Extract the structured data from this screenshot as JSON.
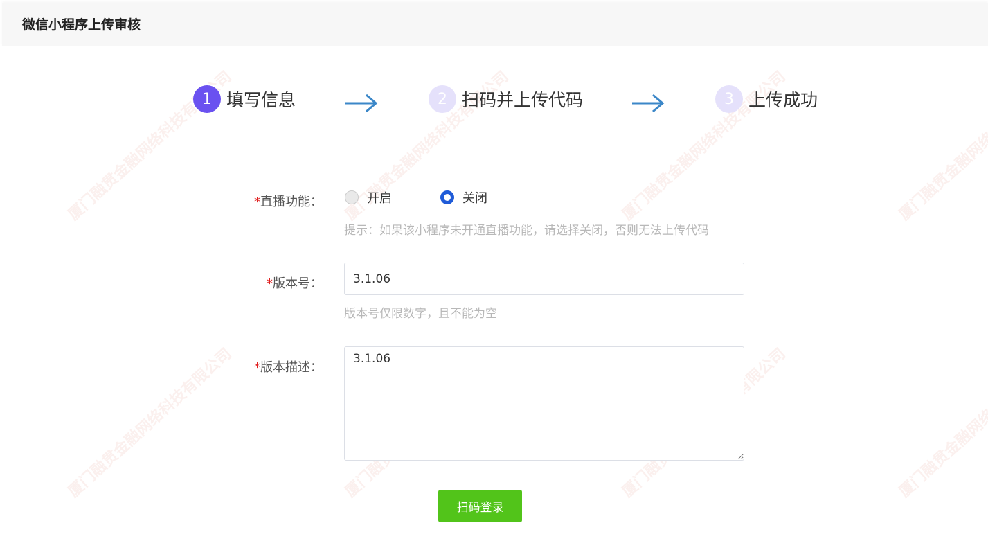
{
  "header": {
    "title": "微信小程序上传审核"
  },
  "steps": [
    {
      "number": "1",
      "label": "填写信息",
      "state": "active"
    },
    {
      "number": "2",
      "label": "扫码并上传代码",
      "state": "inactive"
    },
    {
      "number": "3",
      "label": "上传成功",
      "state": "inactive"
    }
  ],
  "form": {
    "live": {
      "required_mark": "*",
      "label": "直播功能：",
      "options": [
        {
          "label": "开启",
          "checked": false
        },
        {
          "label": "关闭",
          "checked": true
        }
      ],
      "hint": "提示：如果该小程序未开通直播功能，请选择关闭，否则无法上传代码"
    },
    "version": {
      "required_mark": "*",
      "label": "版本号：",
      "value": "3.1.06",
      "hint": "版本号仅限数字，且不能为空"
    },
    "description": {
      "required_mark": "*",
      "label": "版本描述：",
      "value": "3.1.06"
    },
    "submit_label": "扫码登录"
  },
  "watermark": {
    "text": "厦门融贯金融网络科技有限公司"
  },
  "colors": {
    "accent": "#6a51f0",
    "step_inactive": "#e5e1fb",
    "radio_checked": "#1f5bd8",
    "submit": "#52c41a",
    "required": "#e02020",
    "arrow": "#3b87c8"
  }
}
